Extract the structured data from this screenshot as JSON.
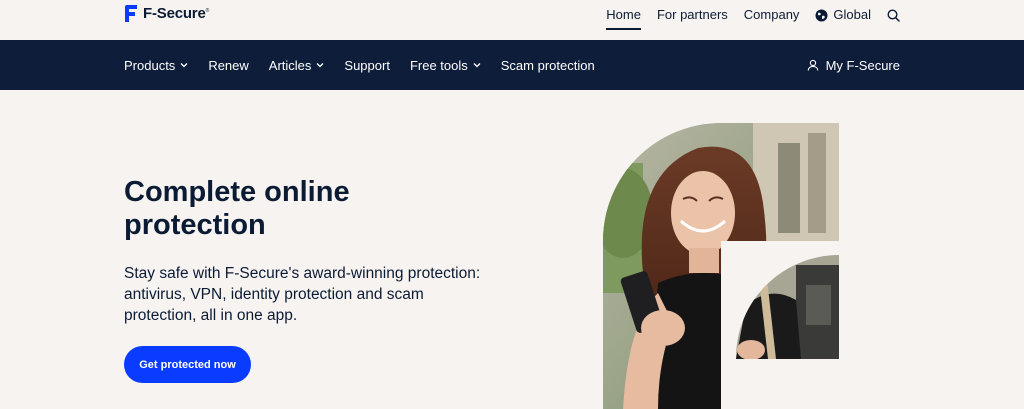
{
  "brand": {
    "name": "F-Secure",
    "mark": "®",
    "color": "#0a3cff"
  },
  "toplinks": [
    {
      "label": "Home",
      "active": true
    },
    {
      "label": "For partners",
      "active": false
    },
    {
      "label": "Company",
      "active": false
    },
    {
      "label": "Global",
      "active": false,
      "icon": "globe-icon"
    }
  ],
  "search_icon": "search-icon",
  "nav": {
    "items": [
      {
        "label": "Products",
        "dropdown": true
      },
      {
        "label": "Renew",
        "dropdown": false
      },
      {
        "label": "Articles",
        "dropdown": true
      },
      {
        "label": "Support",
        "dropdown": false
      },
      {
        "label": "Free tools",
        "dropdown": true
      },
      {
        "label": "Scam protection",
        "dropdown": false
      }
    ],
    "account_label": "My F-Secure",
    "account_icon": "user-icon",
    "background": "#0d1d3a"
  },
  "hero": {
    "title": "Complete online protection",
    "subtitle": "Stay safe with F-Secure's award-winning protection: antivirus, VPN, identity protection and scam protection, all in one app.",
    "cta_label": "Get protected now",
    "cta_color": "#0a3cff"
  }
}
